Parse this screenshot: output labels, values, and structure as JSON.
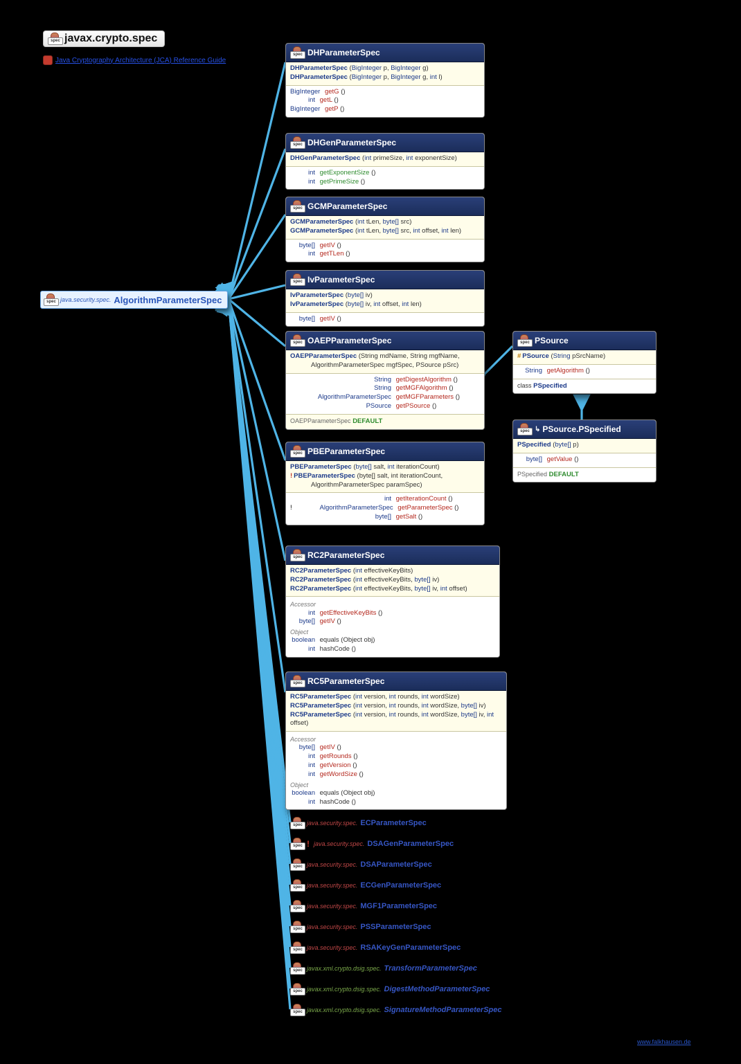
{
  "title": "javax.crypto.spec",
  "ref_guide": "Java Cryptography Architecture (JCA) Reference Guide",
  "footer": "www.falkhausen.de",
  "root": {
    "pkg": "java.security.spec.",
    "cls": "AlgorithmParameterSpec"
  },
  "external_links": [
    {
      "k": "normal",
      "pkg": "java.security.spec.",
      "name": "ECParameterSpec"
    },
    {
      "k": "normal",
      "deprec": "!",
      "pkg": "java.security.spec.",
      "name": "DSAGenParameterSpec"
    },
    {
      "k": "normal",
      "pkg": "java.security.spec.",
      "name": "DSAParameterSpec"
    },
    {
      "k": "normal",
      "pkg": "java.security.spec.",
      "name": "ECGenParameterSpec"
    },
    {
      "k": "normal",
      "pkg": "java.security.spec.",
      "name": "MGF1ParameterSpec"
    },
    {
      "k": "normal",
      "pkg": "java.security.spec.",
      "name": "PSSParameterSpec"
    },
    {
      "k": "normal",
      "pkg": "java.security.spec.",
      "name": "RSAKeyGenParameterSpec"
    },
    {
      "k": "xml",
      "pkg": "javax.xml.crypto.dsig.spec.",
      "name": "TransformParameterSpec"
    },
    {
      "k": "xml",
      "pkg": "javax.xml.crypto.dsig.spec.",
      "name": "DigestMethodParameterSpec"
    },
    {
      "k": "xml",
      "pkg": "javax.xml.crypto.dsig.spec.",
      "name": "SignatureMethodParameterSpec"
    }
  ],
  "boxes": {
    "dh": {
      "title": "DHParameterSpec",
      "ctors": [
        {
          "name": "DHParameterSpec",
          "params": [
            [
              "BigInteger",
              "p"
            ],
            [
              "BigInteger",
              "g"
            ]
          ]
        },
        {
          "name": "DHParameterSpec",
          "params": [
            [
              "BigInteger",
              "p"
            ],
            [
              "BigInteger",
              "g"
            ],
            [
              "int",
              "l"
            ]
          ]
        }
      ],
      "methods": [
        {
          "ret": "BigInteger",
          "name": "getG"
        },
        {
          "ret": "int",
          "name": "getL"
        },
        {
          "ret": "BigInteger",
          "name": "getP"
        }
      ]
    },
    "dhgen": {
      "title": "DHGenParameterSpec",
      "ctors": [
        {
          "name": "DHGenParameterSpec",
          "params": [
            [
              "int",
              "primeSize"
            ],
            [
              "int",
              "exponentSize"
            ]
          ]
        }
      ],
      "methods": [
        {
          "ret": "int",
          "name": "getExponentSize"
        },
        {
          "ret": "int",
          "name": "getPrimeSize"
        }
      ]
    },
    "gcm": {
      "title": "GCMParameterSpec",
      "ctors": [
        {
          "name": "GCMParameterSpec",
          "params": [
            [
              "int",
              "tLen"
            ],
            [
              "byte[]",
              "src"
            ]
          ]
        },
        {
          "name": "GCMParameterSpec",
          "params": [
            [
              "int",
              "tLen"
            ],
            [
              "byte[]",
              "src"
            ],
            [
              "int",
              "offset"
            ],
            [
              "int",
              "len"
            ]
          ]
        }
      ],
      "methods": [
        {
          "ret": "byte[]",
          "name": "getIV"
        },
        {
          "ret": "int",
          "name": "getTLen"
        }
      ]
    },
    "iv": {
      "title": "IvParameterSpec",
      "ctors": [
        {
          "name": "IvParameterSpec",
          "params": [
            [
              "byte[]",
              "iv"
            ]
          ]
        },
        {
          "name": "IvParameterSpec",
          "params": [
            [
              "byte[]",
              "iv"
            ],
            [
              "int",
              "offset"
            ],
            [
              "int",
              "len"
            ]
          ]
        }
      ],
      "methods": [
        {
          "ret": "byte[]",
          "name": "getIV"
        }
      ]
    },
    "oaep": {
      "title": "OAEPParameterSpec",
      "ctor_multiline": {
        "name": "OAEPParameterSpec",
        "l1": "(String mdName, String mgfName,",
        "l2": "AlgorithmParameterSpec mgfSpec, PSource pSrc)"
      },
      "methods": [
        {
          "ret": "String",
          "name": "getDigestAlgorithm"
        },
        {
          "ret": "String",
          "name": "getMGFAlgorithm"
        },
        {
          "ret": "AlgorithmParameterSpec",
          "name": "getMGFParameters"
        },
        {
          "ret": "PSource",
          "name": "getPSource"
        }
      ],
      "const_prefix": "OAEPParameterSpec",
      "const": "DEFAULT"
    },
    "pbe": {
      "title": "PBEParameterSpec",
      "ctors": [
        {
          "name": "PBEParameterSpec",
          "params": [
            [
              "byte[]",
              "salt"
            ],
            [
              "int",
              "iterationCount"
            ]
          ]
        }
      ],
      "ctor_multi": {
        "deprec": "!",
        "name": "PBEParameterSpec",
        "l1": "(byte[] salt, int iterationCount,",
        "l2": "AlgorithmParameterSpec paramSpec)"
      },
      "methods": [
        {
          "ret": "int",
          "name": "getIterationCount"
        },
        {
          "deprec": "!",
          "ret": "AlgorithmParameterSpec",
          "name": "getParameterSpec"
        },
        {
          "ret": "byte[]",
          "name": "getSalt"
        }
      ]
    },
    "rc2": {
      "title": "RC2ParameterSpec",
      "ctors": [
        {
          "name": "RC2ParameterSpec",
          "params": [
            [
              "int",
              "effectiveKeyBits"
            ]
          ]
        },
        {
          "name": "RC2ParameterSpec",
          "params": [
            [
              "int",
              "effectiveKeyBits"
            ],
            [
              "byte[]",
              "iv"
            ]
          ]
        },
        {
          "name": "RC2ParameterSpec",
          "params": [
            [
              "int",
              "effectiveKeyBits"
            ],
            [
              "byte[]",
              "iv"
            ],
            [
              "int",
              "offset"
            ]
          ]
        }
      ],
      "group_acc": "Accessor",
      "acc": [
        {
          "ret": "int",
          "name": "getEffectiveKeyBits"
        },
        {
          "ret": "byte[]",
          "name": "getIV"
        }
      ],
      "group_obj": "Object",
      "obj": [
        {
          "ret": "boolean",
          "name": "equals",
          "params": "(Object obj)"
        },
        {
          "ret": "int",
          "name": "hashCode",
          "params": "()"
        }
      ]
    },
    "rc5": {
      "title": "RC5ParameterSpec",
      "ctors": [
        {
          "name": "RC5ParameterSpec",
          "params": [
            [
              "int",
              "version"
            ],
            [
              "int",
              "rounds"
            ],
            [
              "int",
              "wordSize"
            ]
          ]
        },
        {
          "name": "RC5ParameterSpec",
          "params": [
            [
              "int",
              "version"
            ],
            [
              "int",
              "rounds"
            ],
            [
              "int",
              "wordSize"
            ],
            [
              "byte[]",
              "iv"
            ]
          ]
        },
        {
          "name": "RC5ParameterSpec",
          "params": [
            [
              "int",
              "version"
            ],
            [
              "int",
              "rounds"
            ],
            [
              "int",
              "wordSize"
            ],
            [
              "byte[]",
              "iv"
            ],
            [
              "int",
              "offset"
            ]
          ]
        }
      ],
      "group_acc": "Accessor",
      "acc": [
        {
          "ret": "byte[]",
          "name": "getIV"
        },
        {
          "ret": "int",
          "name": "getRounds"
        },
        {
          "ret": "int",
          "name": "getVersion"
        },
        {
          "ret": "int",
          "name": "getWordSize"
        }
      ],
      "group_obj": "Object",
      "obj": [
        {
          "ret": "boolean",
          "name": "equals",
          "params": "(Object obj)"
        },
        {
          "ret": "int",
          "name": "hashCode",
          "params": "()"
        }
      ]
    },
    "psource": {
      "title": "PSource",
      "ctor": {
        "hash": "#",
        "name": "PSource",
        "params": [
          [
            "String",
            "pSrcName"
          ]
        ]
      },
      "methods": [
        {
          "ret": "String",
          "name": "getAlgorithm"
        }
      ],
      "inner_prefix": "class",
      "inner": "PSpecified"
    },
    "pspecified": {
      "title": "PSource.PSpecified",
      "ctors": [
        {
          "name": "PSpecified",
          "params": [
            [
              "byte[]",
              "p"
            ]
          ]
        }
      ],
      "methods": [
        {
          "ret": "byte[]",
          "name": "getValue"
        }
      ],
      "const_prefix": "PSpecified",
      "const": "DEFAULT"
    }
  }
}
